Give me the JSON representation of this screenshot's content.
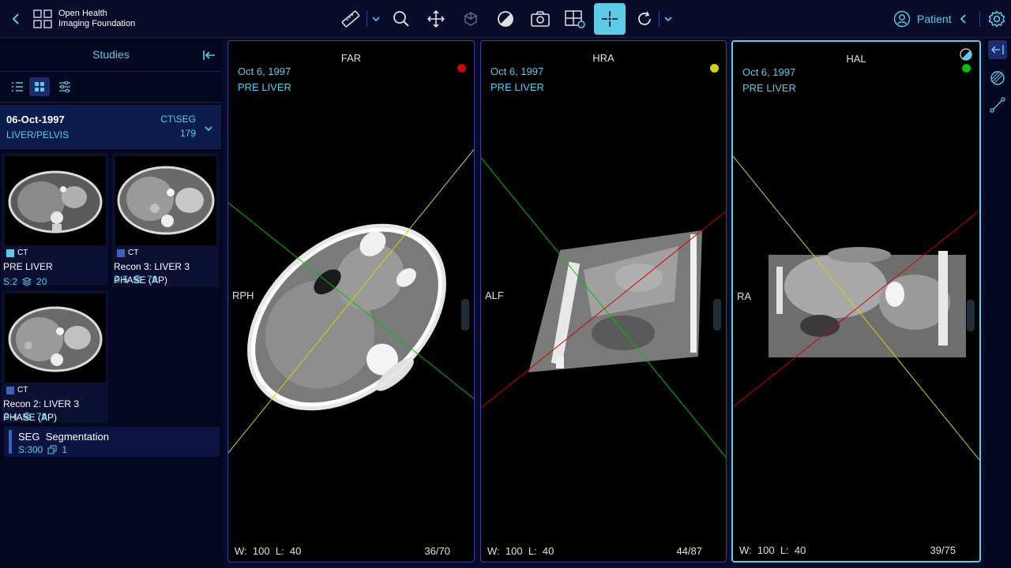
{
  "header": {
    "logo_line1": "Open Health",
    "logo_line2": "Imaging Foundation",
    "patient_label": "Patient",
    "tools": [
      "ruler-icon",
      "zoom-icon",
      "pan-icon",
      "3d-rotate-icon",
      "window-level-icon",
      "capture-icon",
      "layout-icon",
      "crosshairs-icon",
      "rotate-icon"
    ]
  },
  "sidebar": {
    "title": "Studies",
    "study": {
      "date": "06-Oct-1997",
      "description": "LIVER/PELVIS",
      "modality": "CT\\SEG",
      "count": "179"
    },
    "series": [
      {
        "modality": "CT",
        "name": "PRE LIVER",
        "series_no": "S:2",
        "instances": "20",
        "color": "#5acce6"
      },
      {
        "modality": "CT",
        "name": "Recon 3: LIVER 3 PHASE (AP)",
        "series_no": "S:5",
        "instances": "79",
        "color": "#3b64b8"
      },
      {
        "modality": "CT",
        "name": "Recon 2: LIVER 3 PHASE (AP)",
        "series_no": "S:4",
        "instances": "79",
        "color": "#3b64b8"
      }
    ],
    "segmentation": {
      "modality": "SEG",
      "name": "Segmentation",
      "series_no": "S:300",
      "instances": "1"
    }
  },
  "viewports": [
    {
      "orient_top": "FAR",
      "orient_left": "RPH",
      "date": "Oct 6, 1997",
      "series": "PRE LIVER",
      "dot_color": "#d40000",
      "w_label": "W:",
      "w": "100",
      "l_label": "L:",
      "l": "40",
      "index": "36/70"
    },
    {
      "orient_top": "HRA",
      "orient_left": "ALF",
      "date": "Oct 6, 1997",
      "series": "PRE LIVER",
      "dot_color": "#d4d400",
      "w_label": "W:",
      "w": "100",
      "l_label": "L:",
      "l": "40",
      "index": "44/87"
    },
    {
      "orient_top": "HAL",
      "orient_left": "RA",
      "date": "Oct 6, 1997",
      "series": "PRE LIVER",
      "dot_color": "#00c000",
      "w_label": "W:",
      "w": "100",
      "l_label": "L:",
      "l": "40",
      "index": "39/75"
    }
  ],
  "colors": {
    "accent": "#5acce6",
    "background": "#090c29",
    "panel": "#040720"
  }
}
